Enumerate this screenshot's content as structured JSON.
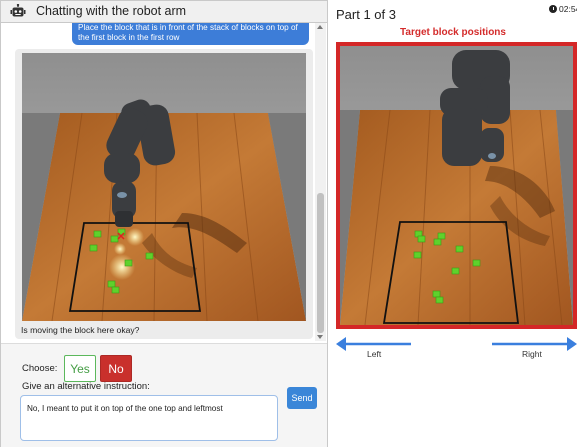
{
  "chat": {
    "title": "Chatting with the robot arm",
    "user_message": "Place the block that is in front of the stack of blocks on top of the first block in the first row",
    "robot_question": "Is moving the block here okay?"
  },
  "controls": {
    "choose_label": "Choose:",
    "yes_label": "Yes",
    "no_label": "No",
    "alt_label": "Give an alternative instruction:",
    "alt_value": "No, I meant to put it on top of the one top and leftmost",
    "send_label": "Send"
  },
  "target": {
    "part_label": "Part 1 of 3",
    "timer": "02:54",
    "title": "Target block positions",
    "left_label": "Left",
    "right_label": "Right"
  },
  "colors": {
    "accent_blue": "#3d7dd8",
    "yes_green": "#5cb85c",
    "no_red": "#c9302c",
    "target_red": "#d42727",
    "block_green": "#5fd12c"
  },
  "icons": {
    "header": "robot-icon",
    "timer": "clock-icon",
    "nav_left": "arrow-left-icon",
    "nav_right": "arrow-right-icon"
  }
}
